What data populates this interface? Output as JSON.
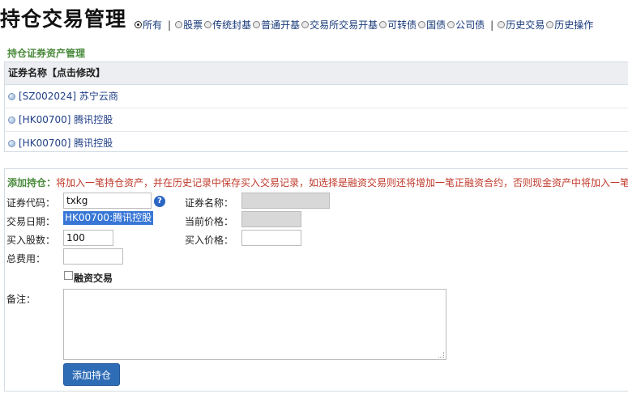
{
  "header": {
    "title": "持仓交易管理",
    "filters": [
      {
        "label": "所有",
        "selected": true
      },
      {
        "label": "|",
        "separator": true
      },
      {
        "label": "股票",
        "selected": false
      },
      {
        "label": "传统封基",
        "selected": false
      },
      {
        "label": "普通开基",
        "selected": false
      },
      {
        "label": "交易所交易开基",
        "selected": false
      },
      {
        "label": "可转债",
        "selected": false
      },
      {
        "label": "国债",
        "selected": false
      },
      {
        "label": "公司债",
        "selected": false
      },
      {
        "label": "|",
        "separator": true
      },
      {
        "label": "历史交易",
        "selected": false
      },
      {
        "label": "历史操作",
        "selected": false
      }
    ]
  },
  "holdings": {
    "section_title": "持仓证券资产管理",
    "column_header": "证券名称【点击修改】",
    "rows": [
      {
        "label": "[SZ002024] 苏宁云商"
      },
      {
        "label": "[HK00700] 腾讯控股"
      },
      {
        "label": "[HK00700] 腾讯控股"
      }
    ]
  },
  "add_form": {
    "title": "添加持仓：",
    "note": "将加入一笔持仓资产，并在历史记录中保存买入交易记录，如选择是融资交易则还将增加一笔正融资合约，否则现金资产中将加入一笔",
    "code_label": "证券代码：",
    "code_value": "txkg",
    "help_icon": "?",
    "date_label": "交易日期：",
    "suggestion_value": "HK00700:腾讯控股",
    "shares_label": "买入股数：",
    "shares_value": "100",
    "fee_label": "总费用：",
    "fee_value": "",
    "name_label": "证券名称：",
    "name_value": "",
    "price_now_label": "当前价格：",
    "price_now_value": "",
    "buy_price_label": "买入价格：",
    "buy_price_value": "",
    "margin_label": "融资交易",
    "remark_label": "备注：",
    "remark_value": "",
    "submit_label": "添加持仓"
  }
}
